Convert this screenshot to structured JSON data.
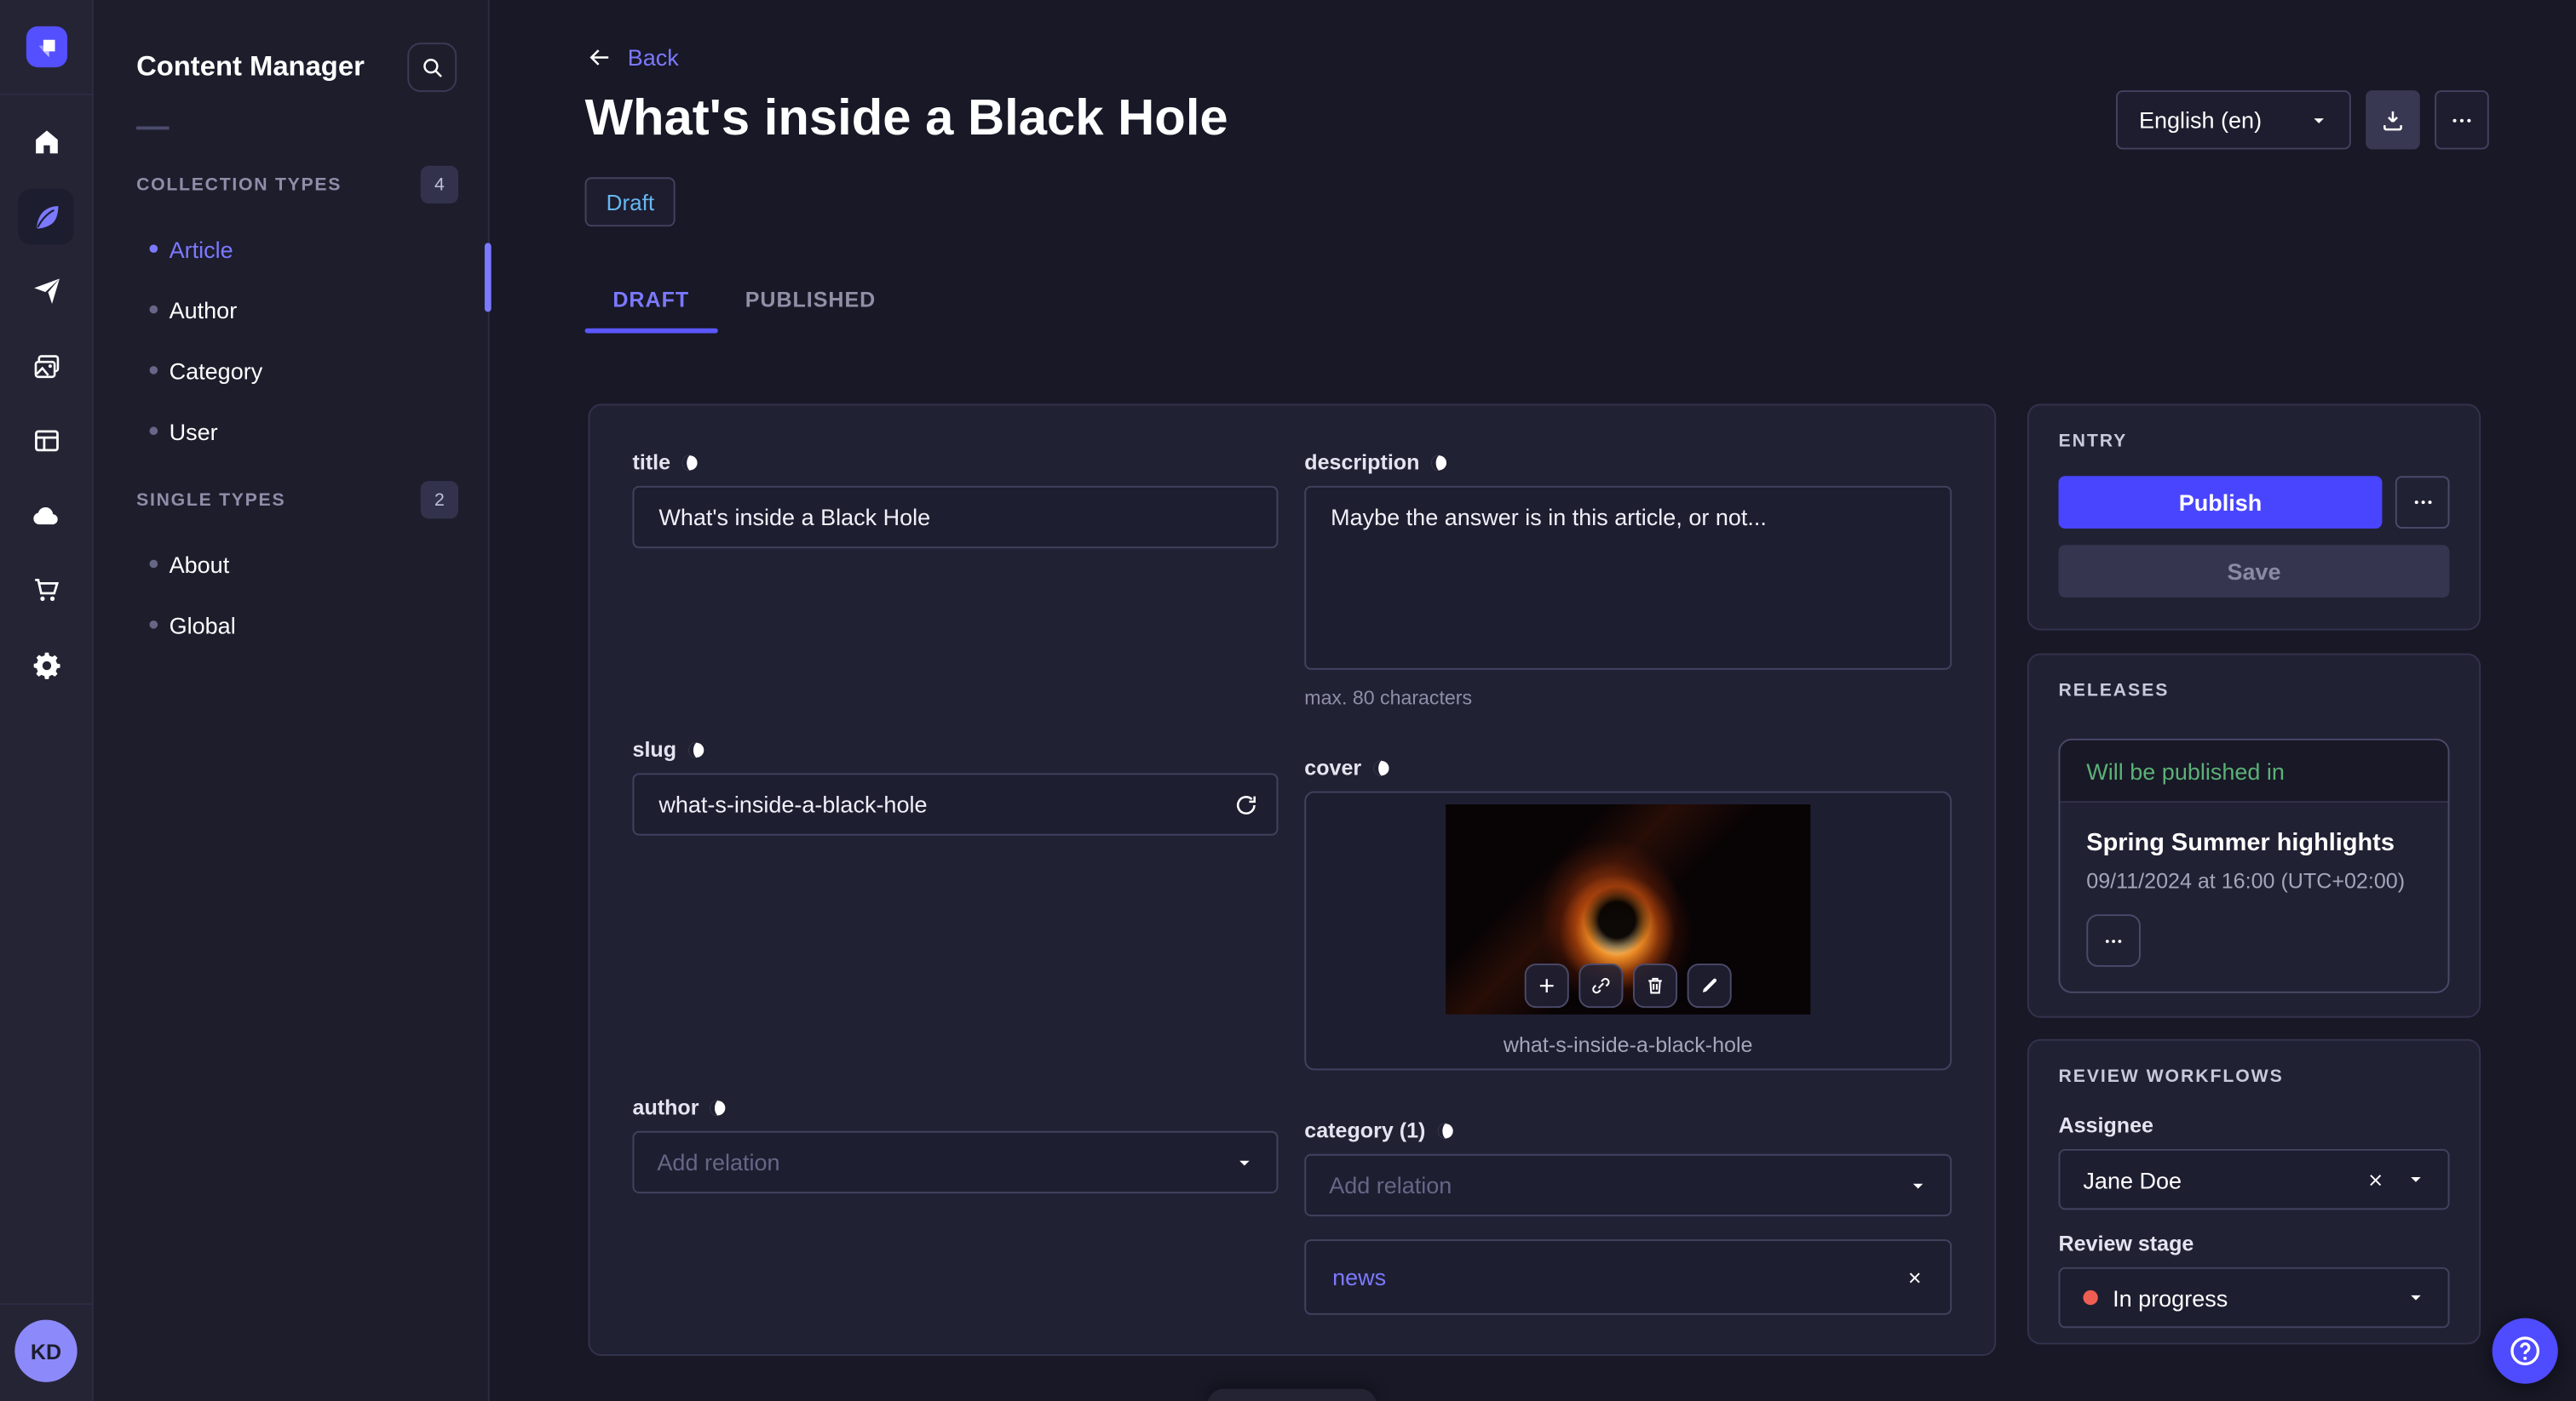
{
  "rail": {
    "avatar_initials": "KD"
  },
  "sidebar": {
    "title": "Content Manager",
    "sections": [
      {
        "label": "COLLECTION TYPES",
        "count": "4",
        "items": [
          {
            "label": "Article"
          },
          {
            "label": "Author"
          },
          {
            "label": "Category"
          },
          {
            "label": "User"
          }
        ]
      },
      {
        "label": "SINGLE TYPES",
        "count": "2",
        "items": [
          {
            "label": "About"
          },
          {
            "label": "Global"
          }
        ]
      }
    ]
  },
  "header": {
    "back_label": "Back",
    "title": "What's inside a Black Hole",
    "status": "Draft",
    "locale": "English (en)"
  },
  "tabs": {
    "draft": "DRAFT",
    "published": "PUBLISHED"
  },
  "form": {
    "title": {
      "label": "title",
      "value": "What's inside a Black Hole"
    },
    "description": {
      "label": "description",
      "value": "Maybe the answer is in this article, or not...",
      "hint": "max. 80 characters"
    },
    "slug": {
      "label": "slug",
      "value": "what-s-inside-a-black-hole"
    },
    "cover": {
      "label": "cover",
      "caption": "what-s-inside-a-black-hole"
    },
    "author": {
      "label": "author",
      "placeholder": "Add relation"
    },
    "category": {
      "label": "category (1)",
      "placeholder": "Add relation",
      "relation": "news"
    }
  },
  "entry": {
    "title": "ENTRY",
    "publish": "Publish",
    "save": "Save"
  },
  "releases": {
    "title": "RELEASES",
    "status": "Will be published in",
    "release": "Spring Summer highlights",
    "date": "09/11/2024 at 16:00 (UTC+02:00)"
  },
  "review": {
    "title": "REVIEW WORKFLOWS",
    "assignee_label": "Assignee",
    "assignee": "Jane Doe",
    "stage_label": "Review stage",
    "stage": "In progress"
  },
  "colors": {
    "primary": "#4945ff",
    "link": "#7b79ff",
    "draft": "#66b7f1",
    "success": "#5cb176",
    "danger": "#ee5e52"
  }
}
